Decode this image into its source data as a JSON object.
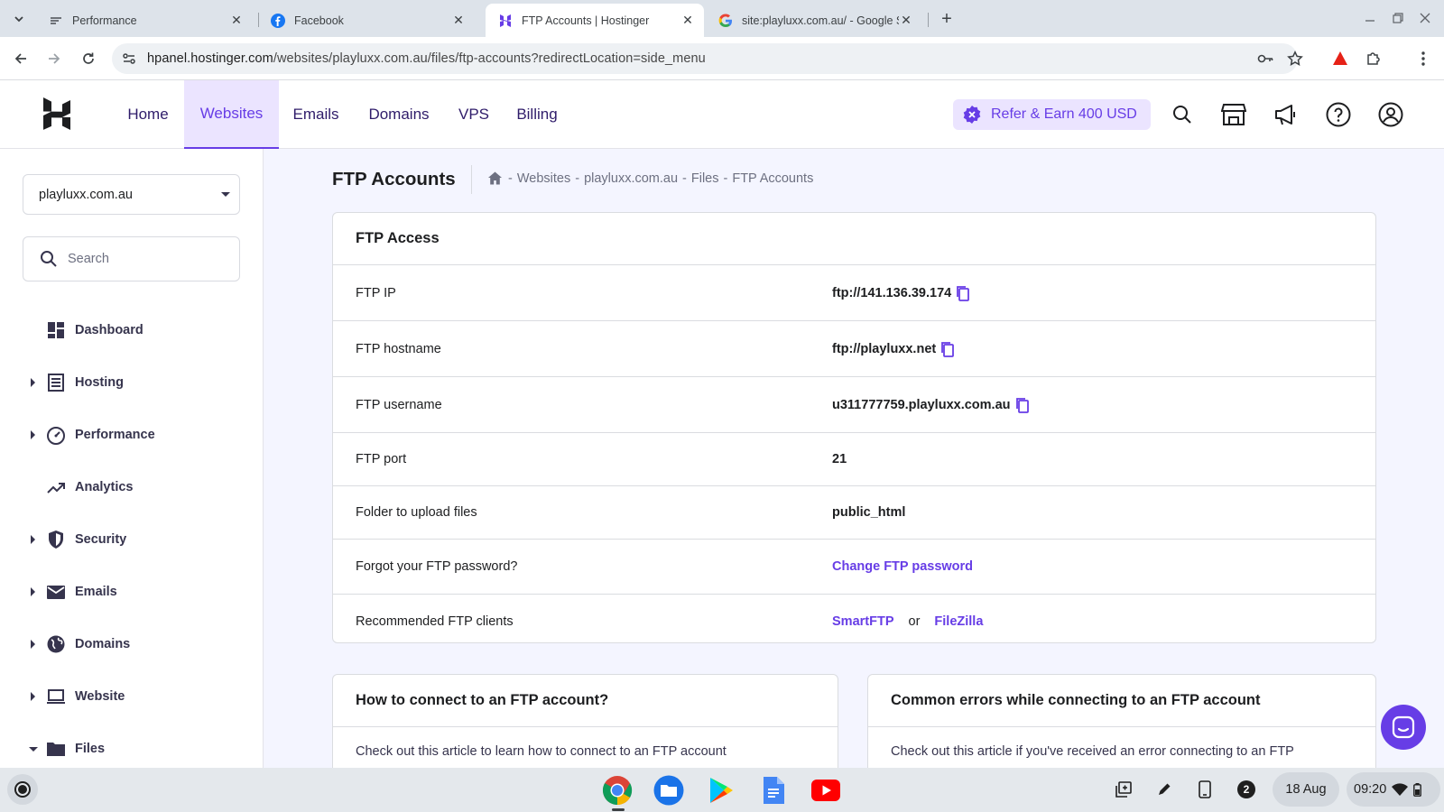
{
  "browser": {
    "tabs": [
      {
        "title": "Performance",
        "favicon": "hostinger-performance-icon",
        "active": false
      },
      {
        "title": "Facebook",
        "favicon": "facebook-icon",
        "active": false
      },
      {
        "title": "FTP Accounts | Hostinger",
        "favicon": "hostinger-icon",
        "active": true
      },
      {
        "title": "site:playluxx.com.au/ - Google S",
        "favicon": "google-icon",
        "active": false
      }
    ],
    "url_host": "hpanel.hostinger.com",
    "url_path": "/websites/playluxx.com.au/files/ftp-accounts?redirectLocation=side_menu"
  },
  "header": {
    "nav": [
      "Home",
      "Websites",
      "Emails",
      "Domains",
      "VPS",
      "Billing"
    ],
    "active_nav": "Websites",
    "refer_label": "Refer & Earn 400 USD",
    "accent": "#673de6"
  },
  "sidebar": {
    "domain": "playluxx.com.au",
    "search_placeholder": "Search",
    "items": [
      {
        "label": "Dashboard",
        "icon": "dashboard-icon",
        "expandable": false
      },
      {
        "label": "Hosting",
        "icon": "hosting-icon",
        "expandable": true
      },
      {
        "label": "Performance",
        "icon": "speedometer-icon",
        "expandable": true
      },
      {
        "label": "Analytics",
        "icon": "trending-up-icon",
        "expandable": false
      },
      {
        "label": "Security",
        "icon": "shield-icon",
        "expandable": true
      },
      {
        "label": "Emails",
        "icon": "mail-icon",
        "expandable": true
      },
      {
        "label": "Domains",
        "icon": "globe-icon",
        "expandable": true
      },
      {
        "label": "Website",
        "icon": "laptop-icon",
        "expandable": true
      },
      {
        "label": "Files",
        "icon": "folder-icon",
        "expandable": true,
        "expanded": true
      }
    ]
  },
  "main": {
    "title": "FTP Accounts",
    "breadcrumb": [
      "Websites",
      "playluxx.com.au",
      "Files",
      "FTP Accounts"
    ],
    "breadcrumb_sep": "-",
    "ftp_access": {
      "heading": "FTP Access",
      "rows": {
        "ip": {
          "label": "FTP IP",
          "value": "ftp://141.136.39.174"
        },
        "hostname": {
          "label": "FTP hostname",
          "value": "ftp://playluxx.net"
        },
        "username": {
          "label": "FTP username",
          "value": "u311777759.playluxx.com.au"
        },
        "port": {
          "label": "FTP port",
          "value": "21"
        },
        "folder": {
          "label": "Folder to upload files",
          "value": "public_html"
        },
        "password": {
          "label": "Forgot your FTP password?",
          "link": "Change FTP password"
        },
        "clients": {
          "label": "Recommended FTP clients",
          "client1": "SmartFTP",
          "or": "or",
          "client2": "FileZilla"
        }
      }
    },
    "info_cards": [
      {
        "heading": "How to connect to an FTP account?",
        "text": "Check out this article to learn how to connect to an FTP account"
      },
      {
        "heading": "Common errors while connecting to an FTP account",
        "text": "Check out this article if you've received an error connecting to an FTP"
      }
    ]
  },
  "shelf": {
    "apps": [
      "chrome-icon",
      "files-icon",
      "play-store-icon",
      "docs-icon",
      "youtube-icon"
    ],
    "notification_count": "2",
    "date": "18 Aug",
    "time": "09:20"
  }
}
